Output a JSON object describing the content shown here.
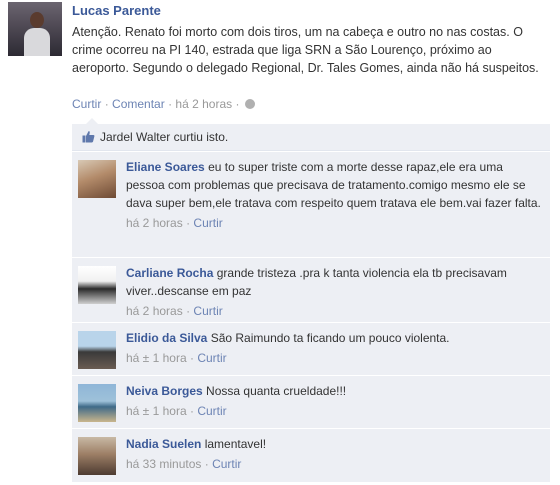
{
  "post": {
    "author": "Lucas Parente",
    "text": "Atenção. Renato foi morto com dois tiros, um na cabeça e outro no nas costas. O crime ocorreu na PI 140, estrada que liga SRN a São Lourenço, próximo ao aeroporto. Segundo o delegado Regional, Dr. Tales Gomes, ainda não há suspeitos.",
    "like_label": "Curtir",
    "comment_label": "Comentar",
    "time": "há 2 horas",
    "separator": "·"
  },
  "likes": {
    "text": "Jardel Walter curtiu isto."
  },
  "comments": [
    {
      "name": "Eliane Soares",
      "text": "eu to super triste com a morte desse rapaz,ele era uma pessoa com problemas que precisava de tratamento.comigo mesmo ele se dava super bem,ele tratava com respeito quem tratava ele bem.vai fazer falta.",
      "time": "há 2 horas",
      "like_label": "Curtir"
    },
    {
      "name": "Carliane Rocha",
      "text": "grande tristeza .pra k tanta violencia ela tb precisavam viver..descanse em paz",
      "time": "há 2 horas",
      "like_label": "Curtir"
    },
    {
      "name": "Elidio da Silva",
      "text": "São Raimundo ta ficando um pouco violenta.",
      "time": "há ± 1 hora",
      "like_label": "Curtir"
    },
    {
      "name": "Neiva Borges",
      "text": "Nossa quanta crueldade!!!",
      "time": "há ± 1 hora",
      "like_label": "Curtir"
    },
    {
      "name": "Nadia Suelen",
      "text": "lamentavel!",
      "time": "há 33 minutos",
      "like_label": "Curtir"
    }
  ],
  "colors": {
    "link": "#3b5998",
    "feedback_bg": "#edeff4",
    "meta": "#999999"
  }
}
